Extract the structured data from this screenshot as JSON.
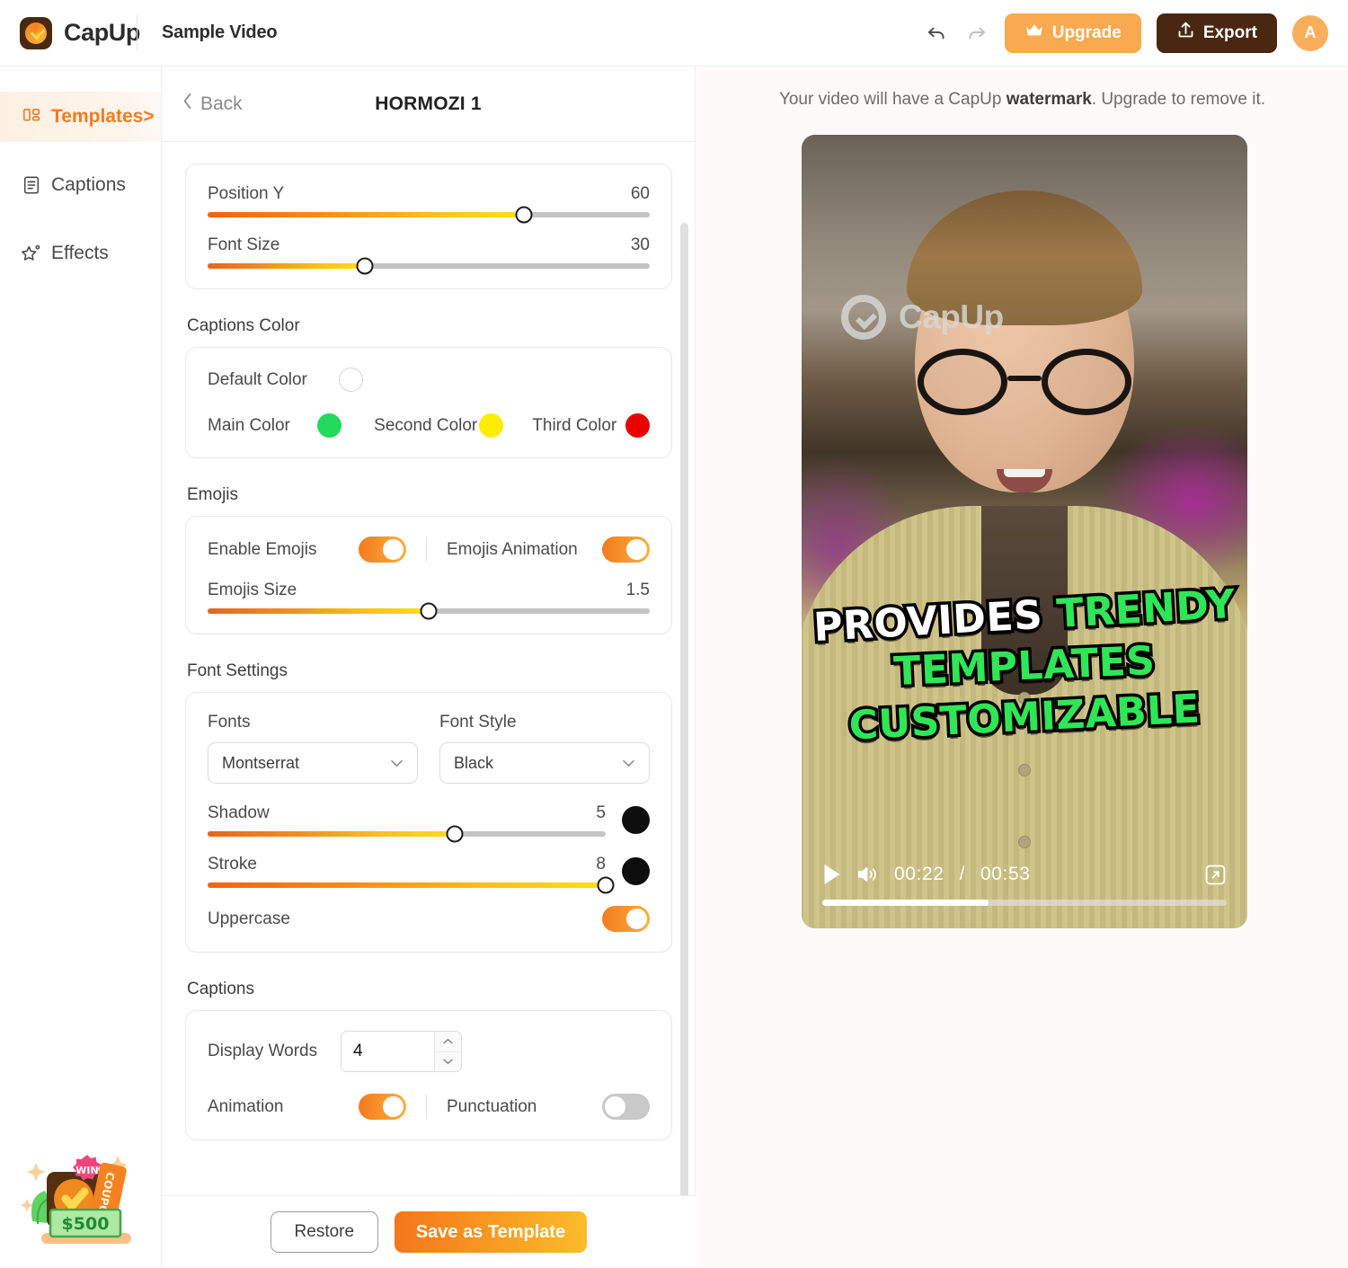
{
  "app": {
    "brand": "CapUp",
    "project_title": "Sample Video",
    "accent": "#f47b20",
    "export_bg": "#4a2710",
    "upgrade_bg": "#f9a94f"
  },
  "topbar": {
    "undo_icon": "undo-icon",
    "redo_icon": "redo-icon",
    "upgrade_label": "Upgrade",
    "export_label": "Export",
    "avatar_initial": "A"
  },
  "sidebar": {
    "items": [
      {
        "label": "Templates>",
        "icon": "templates-icon",
        "active": true
      },
      {
        "label": "Captions",
        "icon": "captions-icon",
        "active": false
      },
      {
        "label": "Effects",
        "icon": "effects-icon",
        "active": false
      }
    ],
    "promo": {
      "badge": "WIN",
      "coupon": "COUPON",
      "amount": "$500"
    }
  },
  "panel": {
    "back_label": "Back",
    "title": "HORMOZI 1",
    "position": {
      "position_y_label": "Position Y",
      "position_y_value": "60",
      "font_size_label": "Font Size",
      "font_size_value": "30"
    },
    "captions_color": {
      "section_label": "Captions Color",
      "default_label": "Default Color",
      "main_label": "Main Color",
      "main_color": "#21d95b",
      "second_label": "Second Color",
      "second_color": "#ffed00",
      "third_label": "Third Color",
      "third_color": "#ea0000"
    },
    "emojis": {
      "section_label": "Emojis",
      "enable_label": "Enable Emojis",
      "enable_on": true,
      "animation_label": "Emojis Animation",
      "animation_on": true,
      "size_label": "Emojis Size",
      "size_value": "1.5"
    },
    "font_settings": {
      "section_label": "Font Settings",
      "fonts_label": "Fonts",
      "font_value": "Montserrat",
      "font_style_label": "Font Style",
      "font_style_value": "Black",
      "shadow_label": "Shadow",
      "shadow_value": "5",
      "shadow_color": "#0e0e0e",
      "stroke_label": "Stroke",
      "stroke_value": "8",
      "stroke_color": "#0e0e0e",
      "uppercase_label": "Uppercase",
      "uppercase_on": true
    },
    "captions": {
      "section_label": "Captions",
      "display_words_label": "Display Words",
      "display_words_value": "4",
      "animation_label": "Animation",
      "animation_on": true,
      "punctuation_label": "Punctuation",
      "punctuation_on": false
    },
    "footer": {
      "restore_label": "Restore",
      "save_label": "Save as Template"
    }
  },
  "preview": {
    "watermark_note_pre": "Your video will have a CapUp ",
    "watermark_note_bold": "watermark",
    "watermark_note_post": ". Upgrade to remove it.",
    "video_watermark": "CapUp",
    "caption_lines": [
      {
        "words": [
          {
            "text": "PROVIDES",
            "color": "white"
          },
          {
            "text": "TRENDY",
            "color": "green"
          }
        ]
      },
      {
        "words": [
          {
            "text": "TEMPLATES",
            "color": "green"
          }
        ]
      },
      {
        "words": [
          {
            "text": "CUSTOMIZABLE",
            "color": "green"
          }
        ]
      }
    ],
    "player": {
      "play_icon": "play-icon",
      "volume_icon": "volume-icon",
      "fullscreen_icon": "fullscreen-icon",
      "current_time": "00:22",
      "separator": "/",
      "duration": "00:53",
      "progress_percent": 41
    }
  }
}
